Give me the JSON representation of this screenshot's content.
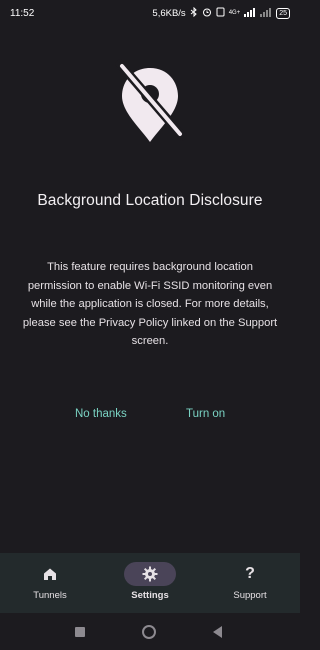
{
  "status_bar": {
    "time": "11:52",
    "net_speed": "5,6KB/s",
    "network_type": "4G+",
    "battery_level": "25",
    "icons": [
      "bluetooth-icon",
      "alarm-icon",
      "signal-icon",
      "wifi-off-icon",
      "battery-icon"
    ]
  },
  "dialog": {
    "icon": "location-off-icon",
    "title": "Background Location Disclosure",
    "body": "This feature requires background location permission to enable Wi-Fi SSID monitoring even while the application is closed. For more details, please see the Privacy Policy linked on the Support screen.",
    "dismiss_label": "No thanks",
    "confirm_label": "Turn on",
    "accent_color": "#7ad3c3"
  },
  "bottom_nav": {
    "items": [
      {
        "label": "Tunnels",
        "icon": "home-icon",
        "selected": false
      },
      {
        "label": "Settings",
        "icon": "gear-icon",
        "selected": true
      },
      {
        "label": "Support",
        "icon": "question-mark-icon",
        "selected": false
      }
    ],
    "selected_color": "#4a4458"
  },
  "system_nav": {
    "buttons": [
      "recents-button",
      "home-button",
      "back-button"
    ]
  }
}
